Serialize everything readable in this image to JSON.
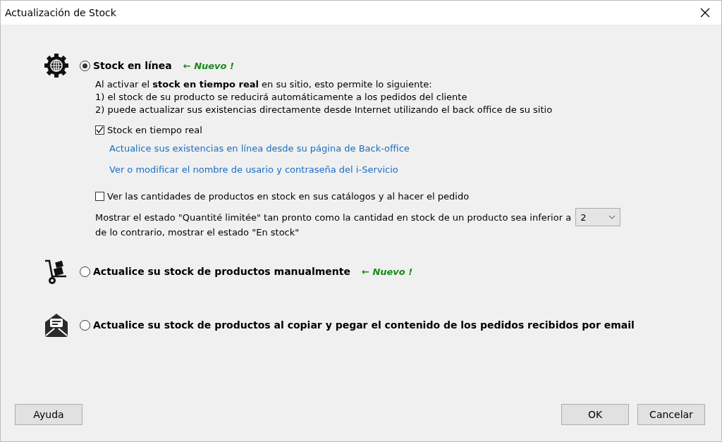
{
  "window": {
    "title": "Actualización de Stock"
  },
  "options": [
    {
      "kind": "online",
      "label": "Stock en línea",
      "selected": true,
      "badge": "← Nuevo !",
      "description": [
        "Al activar el **stock en tiempo real** en su sitio, esto permite lo siguiente:",
        "1) el stock de su producto se reducirá automáticamente a los pedidos del cliente",
        "2) puede actualizar sus existencias directamente desde Internet utilizando el back office de su sitio"
      ],
      "realtime": {
        "label": "Stock en tiempo real",
        "checked": true
      },
      "links": [
        "Actualice sus existencias en línea desde su página de Back-office",
        "Ver o modificar el nombre de usario y contraseña del i-Servicio"
      ],
      "show_quantities": {
        "label": "Ver las cantidades de productos en stock en sus catálogos y al hacer el pedido",
        "checked": false
      },
      "threshold": {
        "text_1": "Mostrar el estado \"Quantité limitée\" tan pronto como la cantidad en stock de un producto sea inferior a",
        "value": "2",
        "text_2": "de lo contrario, mostrar el estado \"En stock\""
      }
    },
    {
      "kind": "manual",
      "label": "Actualice su stock de productos manualmente",
      "selected": false,
      "badge": "← Nuevo !"
    },
    {
      "kind": "email",
      "label": "Actualice su stock de productos al copiar y pegar el contenido de los pedidos recibidos por email",
      "selected": false
    }
  ],
  "buttons": {
    "help": "Ayuda",
    "ok": "OK",
    "cancel": "Cancelar"
  }
}
